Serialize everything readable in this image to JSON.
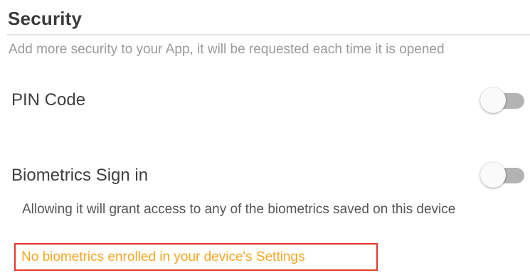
{
  "section": {
    "title": "Security",
    "description": "Add more security to your App, it will be requested each time it is opened"
  },
  "pin": {
    "label": "PIN Code",
    "enabled": false
  },
  "biometrics": {
    "label": "Biometrics Sign in",
    "enabled": false,
    "description": "Allowing it will grant access to any of the biometrics saved on this device",
    "warning": "No biometrics enrolled in your device's Settings"
  },
  "colors": {
    "warning_text": "#f5a623",
    "highlight_border": "#e2382a",
    "toggle_track_off": "#b3b3b3"
  }
}
